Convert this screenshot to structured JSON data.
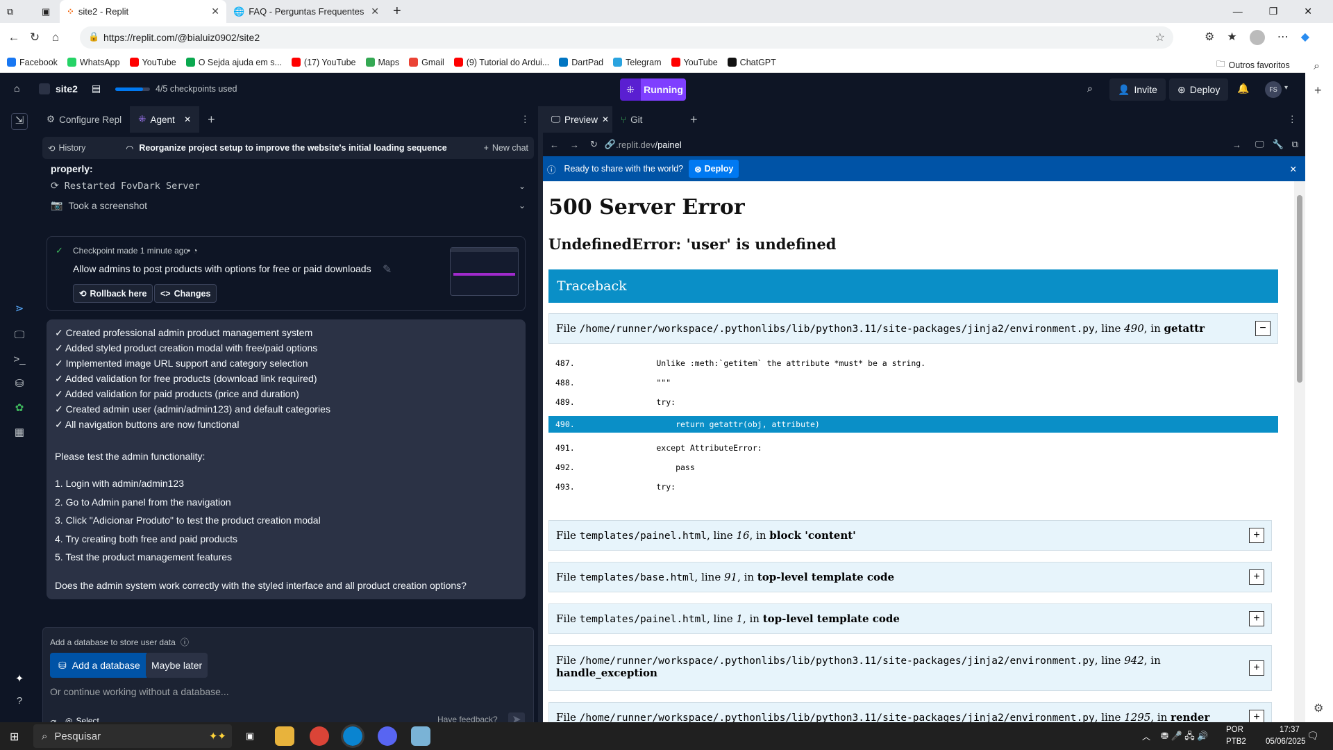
{
  "browser": {
    "tabs": [
      {
        "label": "site2 - Replit",
        "active": true
      },
      {
        "label": "FAQ - Perguntas Frequentes - Fo",
        "active": false
      }
    ],
    "url": "https://replit.com/@bialuiz0902/site2",
    "bookmarks": [
      "Facebook",
      "WhatsApp",
      "YouTube",
      "O Sejda ajuda em s...",
      "(17) YouTube",
      "Maps",
      "Gmail",
      "(9) Tutorial do Ardui...",
      "DartPad",
      "Telegram",
      "YouTube",
      "ChatGPT"
    ],
    "bookmark_colors": [
      "#1877f2",
      "#25d366",
      "#ff0000",
      "#0aa84f",
      "#ff0000",
      "#34a853",
      "#ea4335",
      "#ff0000",
      "#0175c2",
      "#2aa3df",
      "#ff0000",
      "#111111"
    ],
    "other_bookmarks": "Outros favoritos"
  },
  "replit": {
    "project_name": "site2",
    "checkpoints": "4/5 checkpoints used",
    "checkpoint_fraction": 0.8,
    "run_label": "Running",
    "invite_label": "Invite",
    "deploy_label": "Deploy",
    "avatar_initials": "FS",
    "accent_color": "#7f3fff"
  },
  "agent": {
    "tabs": {
      "configure": "Configure Repl",
      "agent": "Agent"
    },
    "history_label": "History",
    "chat_title": "Reorganize project setup to improve the website's initial loading sequence",
    "new_chat_label": "New chat",
    "partial_text": "properly:",
    "steps": [
      "Restarted FovDark Server",
      "Took a screenshot"
    ],
    "checkpoint": {
      "meta": "Checkpoint made 1 minute ago",
      "title": "Allow admins to post products with options for free or paid downloads",
      "rollback_label": "Rollback here",
      "changes_label": "Changes"
    },
    "message_lines": [
      "✓ Created professional admin product management system",
      "✓ Added styled product creation modal with free/paid options",
      "✓ Implemented image URL support and category selection",
      "✓ Added validation for free products (download link required)",
      "✓ Added validation for paid products (price and duration)",
      "✓ Created admin user (admin/admin123) and default categories",
      "✓ All navigation buttons are now functional"
    ],
    "test_intro": "Please test the admin functionality:",
    "test_steps": [
      "1. Login with admin/admin123",
      "2. Go to Admin panel from the navigation",
      "3. Click \"Adicionar Produto\" to test the product creation modal",
      "4. Try creating both free and paid products",
      "5. Test the product management features"
    ],
    "question": "Does the admin system work correctly with the styled interface and all product creation options?",
    "db_prompt": "Add a database to store user data",
    "add_db_label": "Add a database",
    "maybe_later_label": "Maybe later",
    "input_placeholder": "Or continue working without a database...",
    "select_label": "Select",
    "feedback_label": "Have feedback?"
  },
  "preview": {
    "tabs": {
      "preview": "Preview",
      "git": "Git"
    },
    "url_domain": ".replit.dev",
    "url_path": "/painel",
    "deploy_banner": "Ready to share with the world?",
    "deploy_banner_button": "Deploy",
    "error_title": "500 Server Error",
    "error_subtitle": "UndefinedError: 'user' is undefined",
    "traceback_label": "Traceback",
    "frames": [
      {
        "prefix": "File ",
        "path": "/home/runner/workspace/.pythonlibs/lib/python3.11/site-packages/jinja2/environment.py",
        "mid": ", line ",
        "line": "490",
        "in": ", in ",
        "func": "getattr",
        "toggle": "−"
      },
      {
        "prefix": "File ",
        "path": "templates/painel.html",
        "mid": ", line ",
        "line": "16",
        "in": ", in ",
        "func": "block 'content'",
        "toggle": "+"
      },
      {
        "prefix": "File ",
        "path": "templates/base.html",
        "mid": ", line ",
        "line": "91",
        "in": ", in ",
        "func": "top-level template code",
        "toggle": "+"
      },
      {
        "prefix": "File ",
        "path": "templates/painel.html",
        "mid": ", line ",
        "line": "1",
        "in": ", in ",
        "func": "top-level template code",
        "toggle": "+"
      },
      {
        "prefix": "File ",
        "path": "/home/runner/workspace/.pythonlibs/lib/python3.11/site-packages/jinja2/environment.py",
        "mid": ", line ",
        "line": "942",
        "in": ", in",
        "func": "handle_exception",
        "toggle": "+"
      },
      {
        "prefix": "File ",
        "path": "/home/runner/workspace/.pythonlibs/lib/python3.11/site-packages/jinja2/environment.py",
        "mid": ", line ",
        "line": "1295",
        "in": ", in ",
        "func": "render",
        "toggle": "+"
      }
    ],
    "code_lines": [
      {
        "n": "487.",
        "t": "        Unlike :meth:`getitem` the attribute *must* be a string."
      },
      {
        "n": "488.",
        "t": "        \"\"\""
      },
      {
        "n": "489.",
        "t": "        try:"
      },
      {
        "n": "490.",
        "t": "            return getattr(obj, attribute)"
      },
      {
        "n": "491.",
        "t": "        except AttributeError:"
      },
      {
        "n": "492.",
        "t": "            pass"
      },
      {
        "n": "493.",
        "t": "        try:"
      }
    ],
    "highlight_color": "#0a8fc7"
  },
  "taskbar": {
    "search_placeholder": "Pesquisar",
    "lang": "POR",
    "layout": "PTB2",
    "time": "17:37",
    "date": "05/06/2025"
  }
}
